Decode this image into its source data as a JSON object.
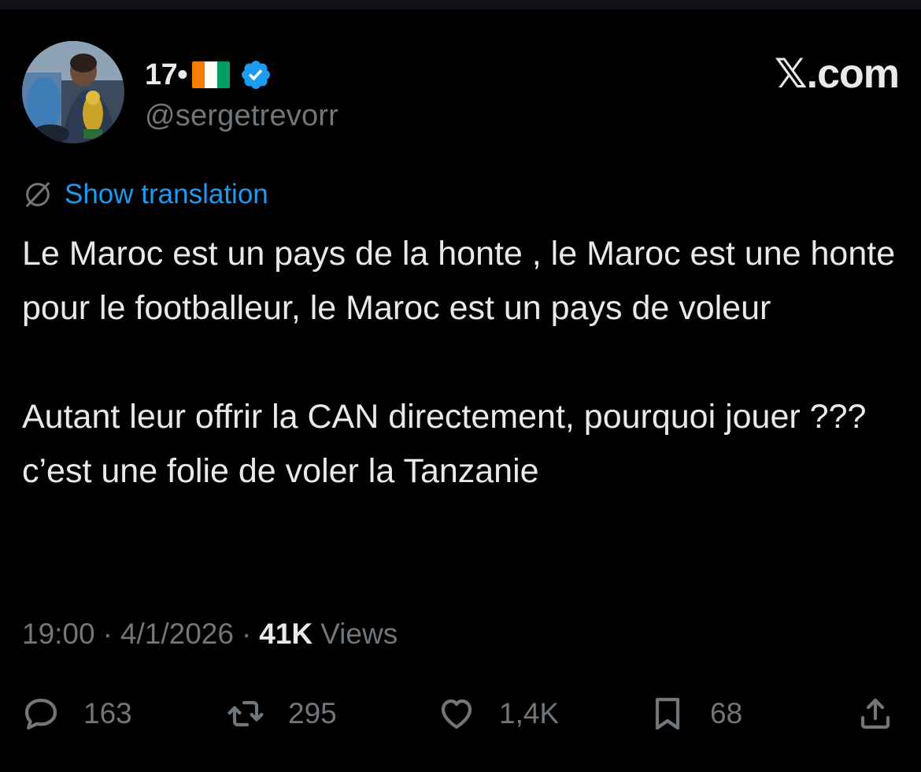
{
  "author": {
    "display_name": "17•",
    "handle": "@sergetrevorr",
    "flag_colors": [
      "#f77f00",
      "#ffffff",
      "#009e60"
    ],
    "verified_color": "#1d9bf0"
  },
  "brand": {
    "x_glyph": "𝕏",
    "suffix": ".com"
  },
  "translate": {
    "label": "Show translation",
    "icon": "translate-globe-icon"
  },
  "tweet": {
    "paragraphs": [
      "Le Maroc est un pays de la honte , le Maroc est une honte pour le footballeur, le Maroc est un pays de voleur",
      "Autant leur offrir la CAN directement, pourquoi jouer ??? c’est une folie de voler la Tanzanie"
    ]
  },
  "meta": {
    "time": "19:00",
    "separator": "·",
    "date": "4/1/2026",
    "views_count": "41K",
    "views_label": "Views"
  },
  "actions": {
    "replies": {
      "icon": "reply-icon",
      "count": "163"
    },
    "reposts": {
      "icon": "repost-icon",
      "count": "295"
    },
    "likes": {
      "icon": "heart-icon",
      "count": "1,4K"
    },
    "bookmarks": {
      "icon": "bookmark-icon",
      "count": "68"
    },
    "share": {
      "icon": "share-icon"
    }
  },
  "colors": {
    "background": "#000000",
    "text": "#e7e9ea",
    "muted": "#71767b",
    "link": "#1d9bf0"
  }
}
